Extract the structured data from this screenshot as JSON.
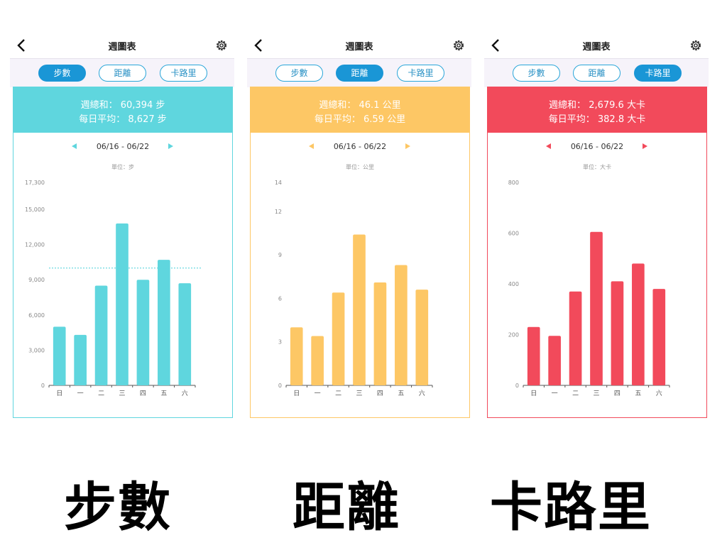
{
  "panels": [
    {
      "id": "steps",
      "header_title": "週圖表",
      "tabs": [
        "步數",
        "距離",
        "卡路里"
      ],
      "active_tab": 0,
      "color": "#5fd6de",
      "summary": {
        "total_label": "週總和：",
        "total_value": "60,394",
        "total_unit": "步",
        "avg_label": "每日平均：",
        "avg_value": "8,627",
        "avg_unit": "步"
      },
      "date_range": "06/16 - 06/22",
      "prev_icon": "triangle-left-icon",
      "next_icon": "triangle-right-icon",
      "unit_label": "單位：步",
      "chart_data": {
        "type": "bar",
        "categories": [
          "日",
          "一",
          "二",
          "三",
          "四",
          "五",
          "六"
        ],
        "values": [
          5000,
          4300,
          8500,
          13800,
          9000,
          10700,
          8700
        ],
        "yticks": [
          "0",
          "3,000",
          "6,000",
          "9,000",
          "12,000",
          "15,000",
          "17,300"
        ],
        "ytick_values": [
          0,
          3000,
          6000,
          9000,
          12000,
          15000,
          17300
        ],
        "ylim": [
          0,
          17300
        ],
        "reference_line": 10000,
        "grid": false
      }
    },
    {
      "id": "distance",
      "header_title": "週圖表",
      "tabs": [
        "步數",
        "距離",
        "卡路里"
      ],
      "active_tab": 1,
      "color": "#fdc765",
      "summary": {
        "total_label": "週總和：",
        "total_value": "46.1",
        "total_unit": "公里",
        "avg_label": "每日平均：",
        "avg_value": "6.59",
        "avg_unit": "公里"
      },
      "date_range": "06/16 - 06/22",
      "prev_icon": "triangle-left-icon",
      "next_icon": "triangle-right-icon",
      "unit_label": "單位：公里",
      "chart_data": {
        "type": "bar",
        "categories": [
          "日",
          "一",
          "二",
          "三",
          "四",
          "五",
          "六"
        ],
        "values": [
          4,
          3.4,
          6.4,
          10.4,
          7.1,
          8.3,
          6.6
        ],
        "yticks": [
          "0",
          "3",
          "6",
          "9",
          "12",
          "14"
        ],
        "ytick_values": [
          0,
          3,
          6,
          9,
          12,
          14
        ],
        "ylim": [
          0,
          14
        ],
        "grid": false
      }
    },
    {
      "id": "calories",
      "header_title": "週圖表",
      "tabs": [
        "步數",
        "距離",
        "卡路里"
      ],
      "active_tab": 2,
      "color": "#f24a5b",
      "summary": {
        "total_label": "週總和：",
        "total_value": "2,679.6",
        "total_unit": "大卡",
        "avg_label": "每日平均：",
        "avg_value": "382.8",
        "avg_unit": "大卡"
      },
      "date_range": "06/16 - 06/22",
      "prev_icon": "triangle-left-icon",
      "next_icon": "triangle-right-icon",
      "unit_label": "單位：大卡",
      "chart_data": {
        "type": "bar",
        "categories": [
          "日",
          "一",
          "二",
          "三",
          "四",
          "五",
          "六"
        ],
        "values": [
          230,
          195,
          370,
          605,
          410,
          480,
          380
        ],
        "yticks": [
          "0",
          "200",
          "400",
          "600",
          "800"
        ],
        "ytick_values": [
          0,
          200,
          400,
          600,
          800
        ],
        "ylim": [
          0,
          800
        ],
        "grid": false
      }
    }
  ],
  "captions": [
    "步數",
    "距離",
    "卡路里"
  ],
  "colors": {
    "tab_active": "#1a96d6",
    "tab_border": "#2aa6d9",
    "tabbar_bg": "#f6f3fa"
  }
}
